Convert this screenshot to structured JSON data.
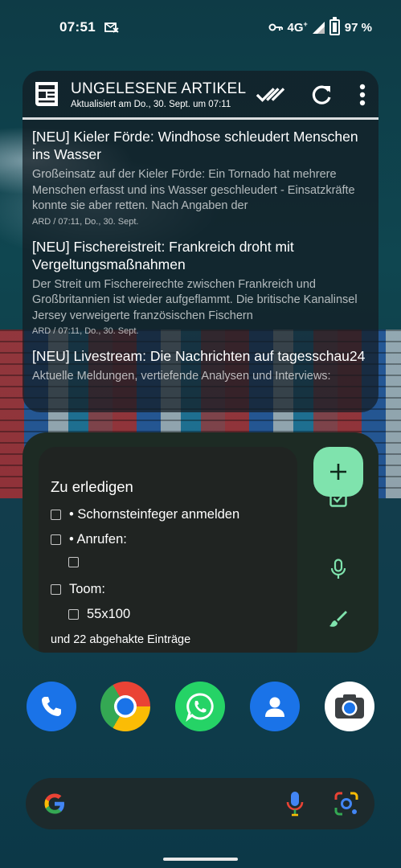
{
  "status_bar": {
    "time": "07:51",
    "network": "4G",
    "battery": "97 %"
  },
  "news_widget": {
    "title": "UNGELESENE ARTIKEL",
    "subtitle": "Aktualisiert am Do., 30. Sept. um 07:11",
    "articles": [
      {
        "title": "[NEU] Kieler Förde: Windhose schleudert Menschen ins Wasser",
        "description": "Großeinsatz auf der Kieler Förde: Ein Tornado hat mehrere Menschen erfasst und ins Wasser geschleudert - Einsatzkräfte konnte sie aber retten. Nach Angaben der",
        "meta": "ARD / 07:11, Do., 30. Sept."
      },
      {
        "title": "[NEU] Fischereistreit: Frankreich droht mit Vergeltungsmaßnahmen",
        "description": "Der Streit um Fischereirechte zwischen Frankreich und Großbritannien ist wieder aufgeflammt. Die britische Kanalinsel Jersey verweigerte französischen Fischern",
        "meta": "ARD / 07:11, Do., 30. Sept."
      },
      {
        "title": "[NEU] Livestream: Die Nachrichten auf tagesschau24",
        "description": "Aktuelle Meldungen, vertiefende Analysen und Interviews:",
        "meta": ""
      }
    ]
  },
  "keep_widget": {
    "note_title": "Zu erledigen",
    "items": [
      {
        "text": "• Schornsteinfeger anmelden",
        "indent": false
      },
      {
        "text": "• Anrufen:",
        "indent": false
      },
      {
        "text": "",
        "indent": true
      },
      {
        "text": "Toom:",
        "indent": false
      },
      {
        "text": "55x100",
        "indent": true
      }
    ],
    "checked_summary": "und 22 abgehakte Einträge"
  },
  "dock": {
    "apps": [
      "phone-icon",
      "chrome-icon",
      "whatsapp-icon",
      "contacts-icon",
      "camera-icon"
    ]
  },
  "colors": {
    "keep_accent": "#7fe3ad",
    "keep_bg": "#1d2b24"
  }
}
